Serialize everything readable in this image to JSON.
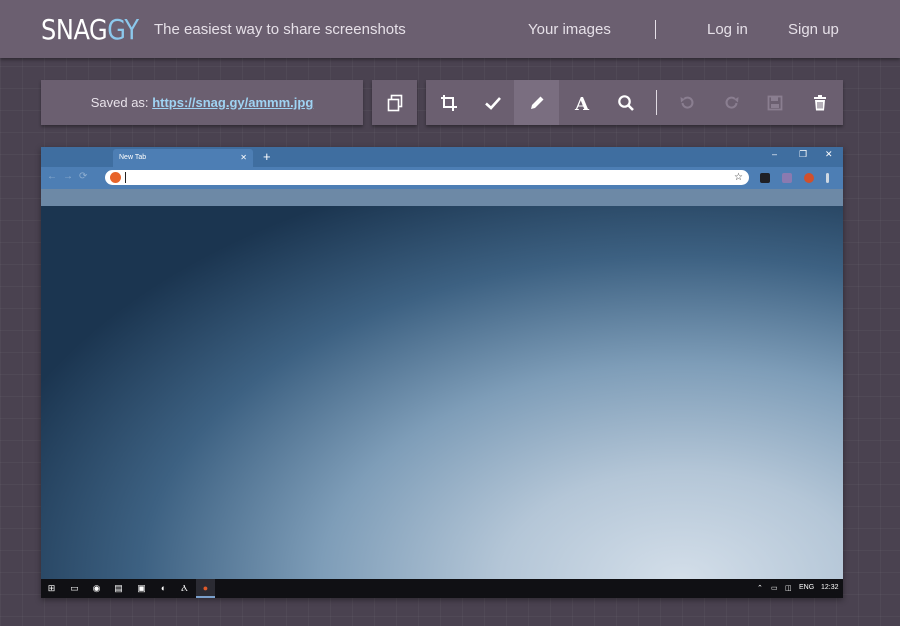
{
  "header": {
    "logo_part1": "SNAG",
    "logo_part2": "GY",
    "tagline": "The easiest way to share screenshots",
    "nav": [
      "Your images",
      "Log in",
      "Sign up"
    ]
  },
  "toolbar": {
    "saved_label": "Saved as:",
    "saved_url": "https://snag.gy/ammm.jpg",
    "tools": [
      {
        "name": "copy-icon",
        "enabled": true
      },
      {
        "name": "crop-icon",
        "enabled": true
      },
      {
        "name": "check-icon",
        "enabled": true
      },
      {
        "name": "pencil-icon",
        "enabled": true,
        "active": true
      },
      {
        "name": "text-icon",
        "enabled": true
      },
      {
        "name": "zoom-icon",
        "enabled": true
      },
      {
        "name": "undo-icon",
        "enabled": false
      },
      {
        "name": "redo-icon",
        "enabled": false
      },
      {
        "name": "save-icon",
        "enabled": false
      },
      {
        "name": "trash-icon",
        "enabled": true
      }
    ]
  },
  "screenshot": {
    "browser_tab_title": "New Tab",
    "tray_language": "ENG",
    "tray_time": "12:32"
  },
  "colors": {
    "header_bg": "#6b5f70",
    "logo_accent": "#8cc8ec",
    "link": "#9fd3f3",
    "page_bg": "#4a4250"
  }
}
